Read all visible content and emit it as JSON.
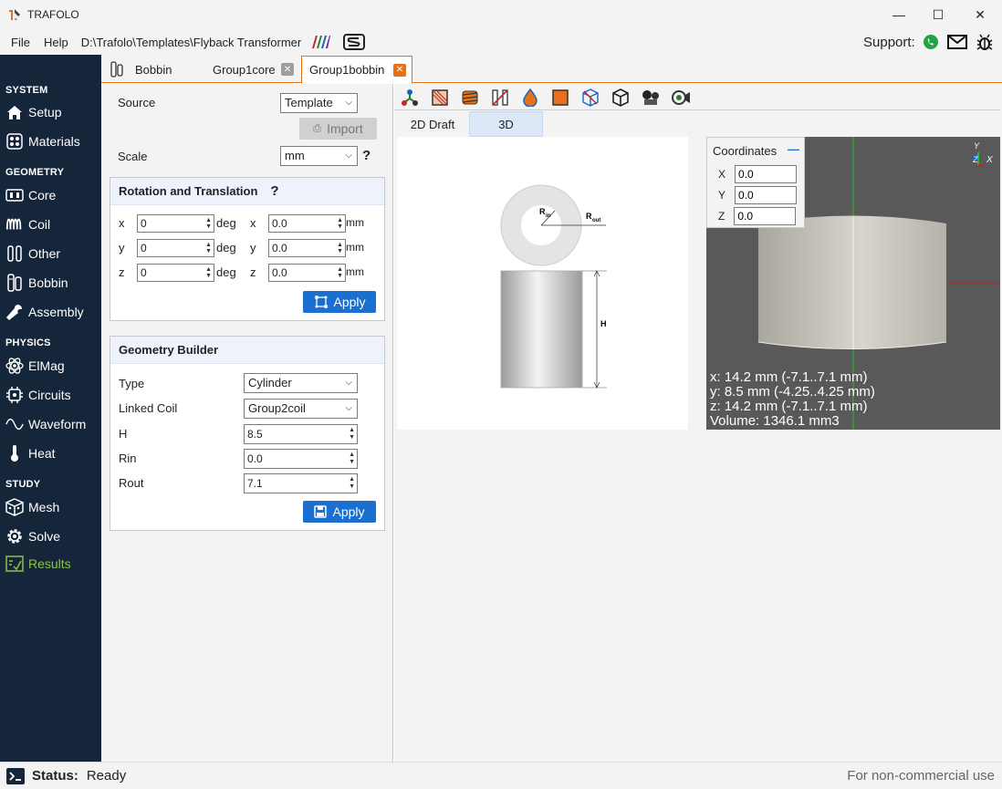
{
  "window": {
    "title": "TRAFOLO",
    "minimize": "—",
    "maximize": "☐",
    "close": "✕"
  },
  "menu": {
    "file": "File",
    "help": "Help",
    "path": "D:\\Trafolo\\Templates\\Flyback Transformer",
    "support": "Support:"
  },
  "sidebar": {
    "sections": [
      "SYSTEM",
      "GEOMETRY",
      "PHYSICS",
      "STUDY"
    ],
    "items": [
      {
        "label": "Setup",
        "icon": "house-icon"
      },
      {
        "label": "Materials",
        "icon": "grid-icon"
      },
      {
        "label": "Core",
        "icon": "core-icon"
      },
      {
        "label": "Coil",
        "icon": "coil-icon"
      },
      {
        "label": "Other",
        "icon": "other-icon"
      },
      {
        "label": "Bobbin",
        "icon": "bobbin-icon"
      },
      {
        "label": "Assembly",
        "icon": "wrench-icon"
      },
      {
        "label": "ElMag",
        "icon": "atom-icon"
      },
      {
        "label": "Circuits",
        "icon": "circuit-icon"
      },
      {
        "label": "Waveform",
        "icon": "wave-icon"
      },
      {
        "label": "Heat",
        "icon": "thermometer-icon"
      },
      {
        "label": "Mesh",
        "icon": "mesh-icon"
      },
      {
        "label": "Solve",
        "icon": "gear-icon"
      },
      {
        "label": "Results",
        "icon": "chart-icon"
      }
    ]
  },
  "tabs": [
    {
      "label": "Bobbin"
    },
    {
      "label": "Group1core"
    },
    {
      "label": "Group1bobbin"
    }
  ],
  "left": {
    "source_label": "Source",
    "source_value": "Template",
    "import_label": "Import",
    "scale_label": "Scale",
    "scale_value": "mm",
    "help_mark": "?",
    "rt": {
      "title": "Rotation and Translation",
      "help": "?",
      "axes": [
        "x",
        "y",
        "z"
      ],
      "rot": [
        "0",
        "0",
        "0"
      ],
      "rot_unit": "deg",
      "trans": [
        "0.0",
        "0.0",
        "0.0"
      ],
      "trans_unit": "mm",
      "apply": "Apply"
    },
    "gb": {
      "title": "Geometry Builder",
      "type_label": "Type",
      "type_value": "Cylinder",
      "linked_label": "Linked Coil",
      "linked_value": "Group2coil",
      "h_label": "H",
      "h_value": "8.5",
      "rin_label": "Rin",
      "rin_value": "0.0",
      "rout_label": "Rout",
      "rout_value": "7.1",
      "apply": "Apply"
    }
  },
  "right": {
    "view_tabs": [
      "2D Draft",
      "3D"
    ],
    "draft": {
      "rin": "R",
      "rin_sub": "in",
      "rout": "R",
      "rout_sub": "out",
      "h": "H"
    },
    "coords": {
      "title": "Coordinates",
      "collapse": "—",
      "x_label": "X",
      "y_label": "Y",
      "z_label": "Z",
      "x": "0.0",
      "y": "0.0",
      "z": "0.0"
    },
    "axes": {
      "y": "Y",
      "z": "Z",
      "x": "X"
    },
    "info": {
      "x": "x: 14.2 mm (-7.1..7.1 mm)",
      "y": "y: 8.5 mm (-4.25..4.25 mm)",
      "z": "z: 14.2 mm (-7.1..7.1 mm)",
      "volume": "Volume: 1346.1 mm3"
    }
  },
  "status": {
    "label": "Status:",
    "value": "Ready",
    "license": "For non-commercial use"
  },
  "colors": {
    "accent": "#e8701a",
    "sidebar": "#16263a",
    "apply": "#1a6fd1",
    "results": "#8bc34a"
  }
}
